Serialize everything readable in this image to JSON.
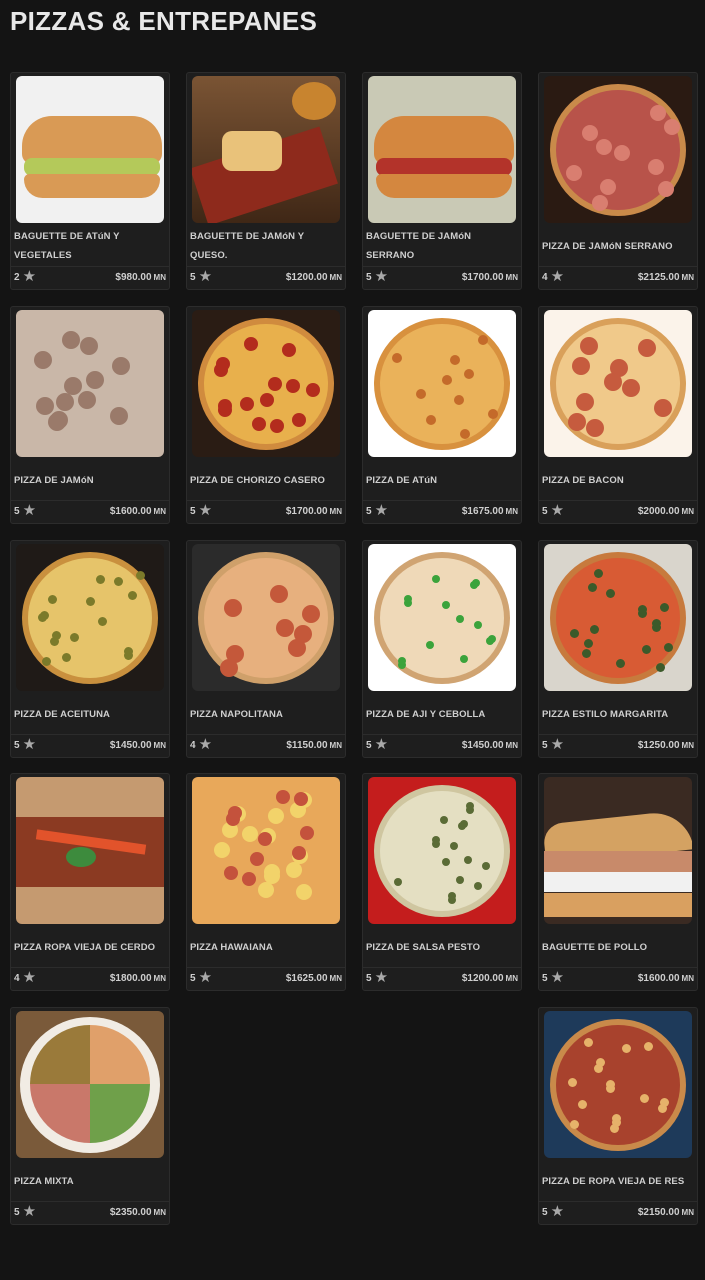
{
  "page": {
    "title": "PIZZAS & ENTREPANES"
  },
  "products": [
    {
      "name": "BAGUETTE DE ATúN Y VEGETALES",
      "rating": "2",
      "price": "$980.00",
      "currency": "MN",
      "photo": "baguette-tuna"
    },
    {
      "name": "BAGUETTE DE JAMóN Y QUESO.",
      "rating": "5",
      "price": "$1200.00",
      "currency": "MN",
      "photo": "baguette-ham-cheese"
    },
    {
      "name": "BAGUETTE DE JAMóN SERRANO",
      "rating": "5",
      "price": "$1700.00",
      "currency": "MN",
      "photo": "baguette-serrano"
    },
    {
      "name": "PIZZA DE JAMóN SERRANO",
      "rating": "4",
      "price": "$2125.00",
      "currency": "MN",
      "photo": "pizza-serrano"
    },
    {
      "name": "PIZZA DE JAMóN",
      "rating": "5",
      "price": "$1600.00",
      "currency": "MN",
      "photo": "pizza-ham"
    },
    {
      "name": "PIZZA DE CHORIZO CASERO",
      "rating": "5",
      "price": "$1700.00",
      "currency": "MN",
      "photo": "pizza-chorizo"
    },
    {
      "name": "PIZZA DE ATúN",
      "rating": "5",
      "price": "$1675.00",
      "currency": "MN",
      "photo": "pizza-tuna"
    },
    {
      "name": "PIZZA DE BACON",
      "rating": "5",
      "price": "$2000.00",
      "currency": "MN",
      "photo": "pizza-bacon"
    },
    {
      "name": "PIZZA DE ACEITUNA",
      "rating": "5",
      "price": "$1450.00",
      "currency": "MN",
      "photo": "pizza-olive"
    },
    {
      "name": "PIZZA NAPOLITANA",
      "rating": "4",
      "price": "$1150.00",
      "currency": "MN",
      "photo": "pizza-napolitana"
    },
    {
      "name": "PIZZA DE AJI Y CEBOLLA",
      "rating": "5",
      "price": "$1450.00",
      "currency": "MN",
      "photo": "pizza-pepper-onion"
    },
    {
      "name": "PIZZA ESTILO MARGARITA",
      "rating": "5",
      "price": "$1250.00",
      "currency": "MN",
      "photo": "pizza-margarita"
    },
    {
      "name": "PIZZA ROPA VIEJA DE CERDO",
      "rating": "4",
      "price": "$1800.00",
      "currency": "MN",
      "photo": "pizza-ropa-vieja-pork"
    },
    {
      "name": "PIZZA HAWAIANA",
      "rating": "5",
      "price": "$1625.00",
      "currency": "MN",
      "photo": "pizza-hawaiian"
    },
    {
      "name": "PIZZA DE SALSA PESTO",
      "rating": "5",
      "price": "$1200.00",
      "currency": "MN",
      "photo": "pizza-pesto"
    },
    {
      "name": "BAGUETTE DE POLLO",
      "rating": "5",
      "price": "$1600.00",
      "currency": "MN",
      "photo": "baguette-chicken"
    },
    {
      "name": "PIZZA MIXTA",
      "rating": "5",
      "price": "$2350.00",
      "currency": "MN",
      "photo": "pizza-mixta"
    },
    {
      "name": "PIZZA DE ROPA VIEJA DE RES",
      "rating": "5",
      "price": "$2150.00",
      "currency": "MN",
      "photo": "pizza-ropa-vieja-beef"
    }
  ],
  "icons": {
    "rating": "star-icon"
  },
  "colors": {
    "background": "#141414",
    "card": "#1e1e1e",
    "text": "#cfcfcf",
    "star": "#a9a9a9"
  }
}
